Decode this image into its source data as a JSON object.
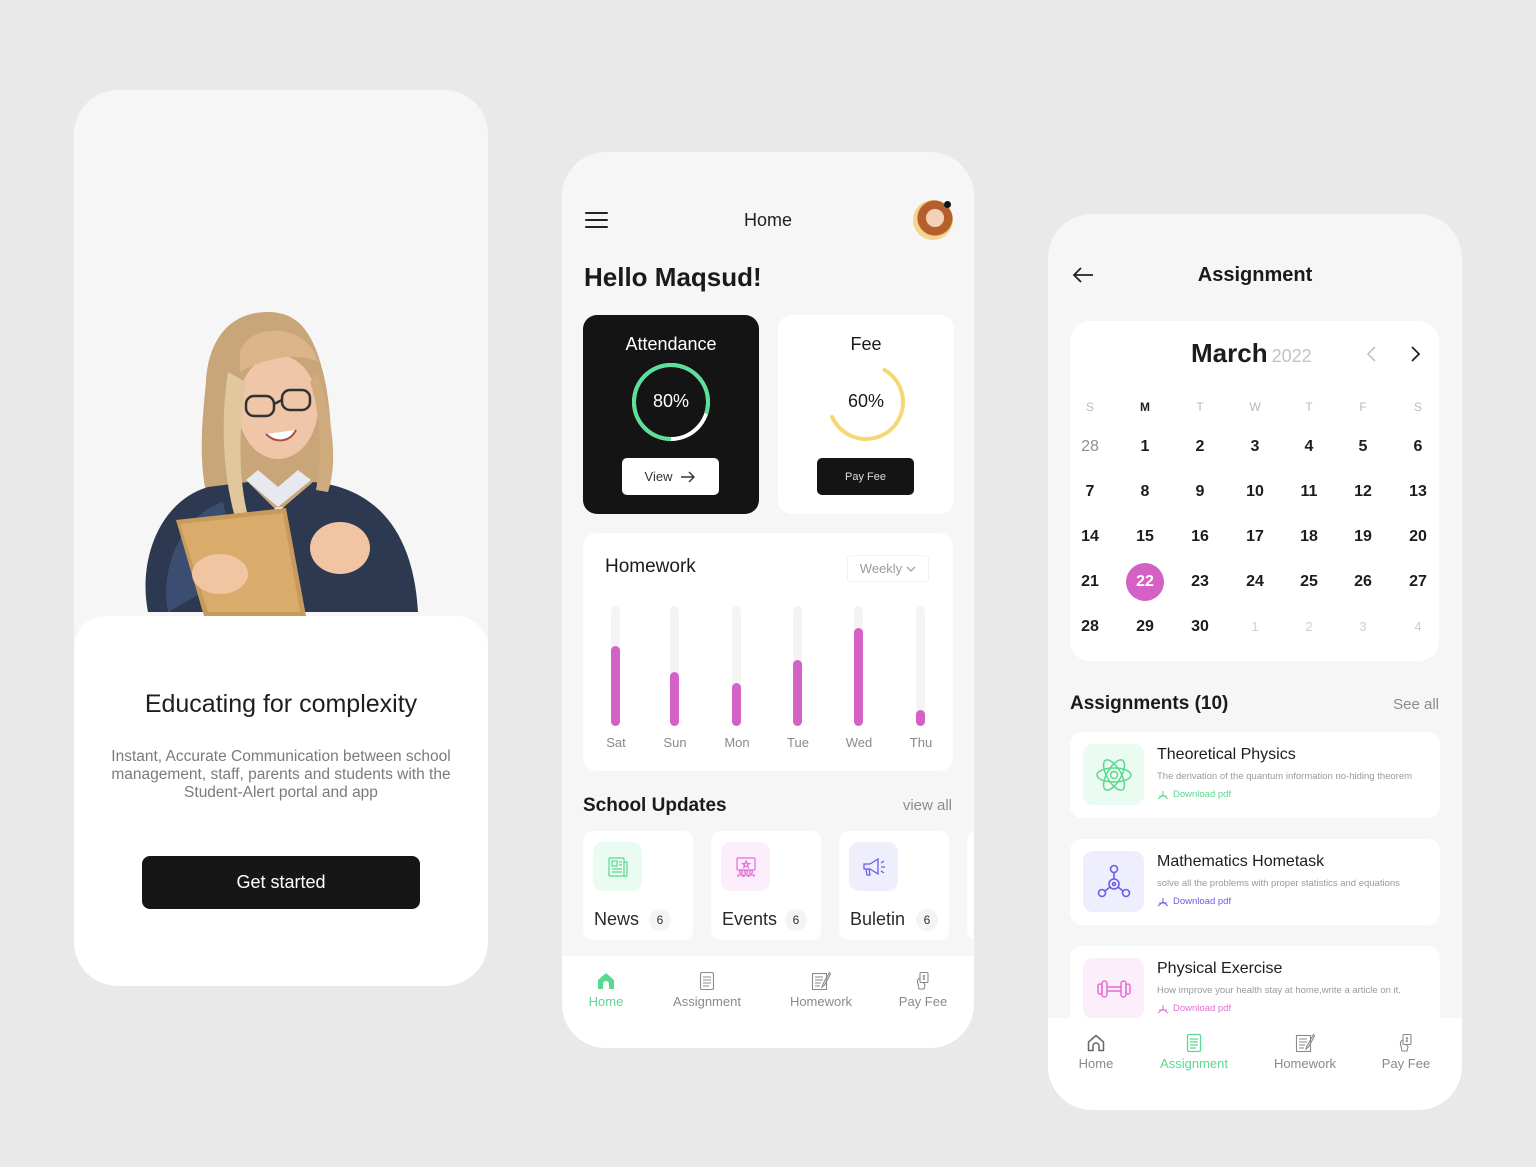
{
  "onboarding": {
    "title": "Educating for complexity",
    "description": "Instant, Accurate Communication between school management, staff, parents and students with the Student-Alert portal and app",
    "cta_label": "Get started"
  },
  "home": {
    "header_title": "Home",
    "greeting": "Hello Maqsud!",
    "attendance": {
      "title": "Attendance",
      "value_label": "80%",
      "progress": 0.8,
      "button_label": "View",
      "color": "#5be09a"
    },
    "fee": {
      "title": "Fee",
      "value_label": "60%",
      "progress": 0.6,
      "button_label": "Pay Fee",
      "color": "#f7d774"
    },
    "homework": {
      "title": "Homework",
      "period_select": "Weekly",
      "bar_color": "#d561c6",
      "bars": [
        {
          "day": "Sat",
          "value": 0.67
        },
        {
          "day": "Sun",
          "value": 0.45
        },
        {
          "day": "Mon",
          "value": 0.36
        },
        {
          "day": "Tue",
          "value": 0.55
        },
        {
          "day": "Wed",
          "value": 0.82
        },
        {
          "day": "Thu",
          "value": 0.13
        }
      ]
    },
    "school_updates": {
      "title": "School Updates",
      "view_all": "view all",
      "items": [
        {
          "label": "News",
          "count": "6",
          "icon": "newspaper-icon",
          "color": "#59d98e",
          "bg": "#eafbf1"
        },
        {
          "label": "Events",
          "count": "6",
          "icon": "event-presentation-icon",
          "color": "#e26fd8",
          "bg": "#fdeefb"
        },
        {
          "label": "Buletin",
          "count": "6",
          "icon": "megaphone-icon",
          "color": "#6c5ce7",
          "bg": "#efeefd"
        }
      ]
    },
    "tabs": [
      {
        "label": "Home",
        "active": true
      },
      {
        "label": "Assignment",
        "active": false
      },
      {
        "label": "Homework",
        "active": false
      },
      {
        "label": "Pay Fee",
        "active": false
      }
    ]
  },
  "assignment": {
    "header_title": "Assignment",
    "calendar": {
      "month": "March",
      "year": "2022",
      "weekdays": [
        "S",
        "M",
        "T",
        "W",
        "T",
        "F",
        "S"
      ],
      "weeks": [
        [
          "28",
          "1",
          "2",
          "3",
          "4",
          "5",
          "6"
        ],
        [
          "7",
          "8",
          "9",
          "10",
          "11",
          "12",
          "13"
        ],
        [
          "14",
          "15",
          "16",
          "17",
          "18",
          "19",
          "20"
        ],
        [
          "21",
          "22",
          "23",
          "24",
          "25",
          "26",
          "27"
        ],
        [
          "28",
          "29",
          "30",
          "1",
          "2",
          "3",
          "4"
        ]
      ],
      "selected_day": "22",
      "accent": "#d561c6"
    },
    "list_title": "Assignments (10)",
    "see_all": "See all",
    "items": [
      {
        "title": "Theoretical Physics",
        "subtitle": "The derivation of the quantum information no-hiding theorem",
        "download": "Download pdf",
        "icon": "atom-icon",
        "color": "#59d98e",
        "bg": "#eafbf1"
      },
      {
        "title": "Mathematics Hometask",
        "subtitle": "solve all the problems with proper statistics and equations",
        "download": "Download pdf",
        "icon": "molecule-icon",
        "color": "#6c5ce7",
        "bg": "#efeefd"
      },
      {
        "title": "Physical Exercise",
        "subtitle": "How improve your health stay at home,write a article on it.",
        "download": "Download pdf",
        "icon": "dumbbell-icon",
        "color": "#e26fd8",
        "bg": "#fdeefb"
      }
    ],
    "tabs": [
      {
        "label": "Home",
        "active": false
      },
      {
        "label": "Assignment",
        "active": true
      },
      {
        "label": "Homework",
        "active": false
      },
      {
        "label": "Pay Fee",
        "active": false
      }
    ]
  }
}
